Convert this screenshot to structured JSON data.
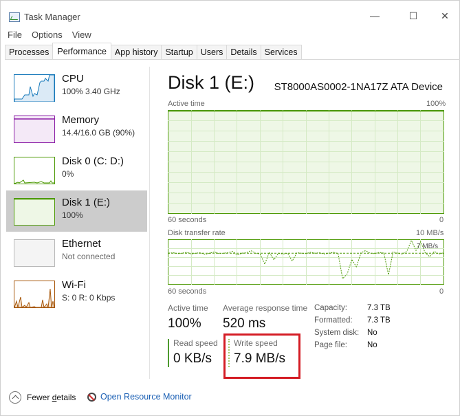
{
  "window": {
    "title": "Task Manager",
    "minimize_glyph": "—",
    "maximize_glyph": "☐",
    "close_glyph": "✕"
  },
  "menu": [
    "File",
    "Options",
    "View"
  ],
  "tabs": [
    "Processes",
    "Performance",
    "App history",
    "Startup",
    "Users",
    "Details",
    "Services"
  ],
  "active_tab": "Performance",
  "sidebar": {
    "items": [
      {
        "name": "CPU",
        "sub": "100% 3.40 GHz",
        "color": "#1779ba"
      },
      {
        "name": "Memory",
        "sub": "14.4/16.0 GB (90%)",
        "color": "#8b1ea6"
      },
      {
        "name": "Disk 0 (C: D:)",
        "sub": "0%",
        "color": "#4e9a06"
      },
      {
        "name": "Disk 1 (E:)",
        "sub": "100%",
        "color": "#4e9a06",
        "selected": true
      },
      {
        "name": "Ethernet",
        "sub": "Not connected",
        "color": "#a0a0a0"
      },
      {
        "name": "Wi-Fi",
        "sub": "S: 0 R: 0 Kbps",
        "color": "#a7570a"
      }
    ]
  },
  "main": {
    "title": "Disk 1 (E:)",
    "device": "ST8000AS0002-1NA17Z ATA Device",
    "active_time_graph": {
      "label": "Active time",
      "max": "100%",
      "time": "60 seconds",
      "min": "0"
    },
    "transfer_graph": {
      "label": "Disk transfer rate",
      "max": "10 MB/s",
      "marker": "7 MB/s",
      "time": "60 seconds",
      "min": "0"
    },
    "stats": {
      "active_time_label": "Active time",
      "active_time_value": "100%",
      "response_label": "Average response time",
      "response_value": "520 ms",
      "read_label": "Read speed",
      "read_value": "0 KB/s",
      "write_label": "Write speed",
      "write_value": "7.9 MB/s"
    },
    "capacity": [
      {
        "label": "Capacity:",
        "value": "7.3 TB"
      },
      {
        "label": "Formatted:",
        "value": "7.3 TB"
      },
      {
        "label": "System disk:",
        "value": "No"
      },
      {
        "label": "Page file:",
        "value": "No"
      }
    ]
  },
  "footer": {
    "fewer_pre": "Fewer ",
    "fewer_ul": "d",
    "fewer_post": "etails",
    "open_rm": "Open Resource Monitor"
  },
  "colors": {
    "disk_green": "#4e9a06",
    "graph_fill": "#eef7e6",
    "graph_grid": "#d4eac4",
    "highlight": "#d41c24",
    "link": "#1a5fb4"
  },
  "transfer_series_mb_s": [
    7.0,
    7.1,
    6.9,
    7.0,
    7.2,
    6.8,
    7.0,
    7.1,
    6.7,
    7.0,
    7.3,
    6.9,
    7.0,
    7.1,
    7.4,
    6.6,
    7.0,
    7.1,
    7.6,
    7.0,
    6.8,
    4.5,
    7.2,
    5.5,
    7.0,
    6.8,
    7.0,
    5.2,
    7.1,
    7.0,
    6.9,
    7.2,
    7.0,
    7.1,
    6.8,
    7.0,
    7.2,
    6.9,
    1.2,
    2.3,
    5.6,
    3.9,
    7.1,
    7.6,
    7.0,
    6.9,
    7.2,
    7.0,
    2.1,
    7.3,
    7.0,
    6.8,
    7.4,
    9.9,
    7.6,
    9.6,
    7.1,
    6.2,
    7.4,
    6.8,
    7.1
  ]
}
